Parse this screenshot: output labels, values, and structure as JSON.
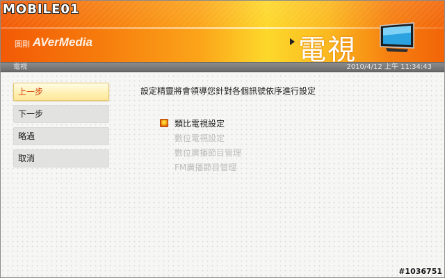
{
  "watermark": {
    "logo": "MOBILE01",
    "id_tag": "#1036751"
  },
  "header": {
    "brand_cn": "圓剛",
    "brand_logo": "AVerMedia",
    "title": "電視",
    "tv_icon": "tv-icon",
    "colors": {
      "gradient_start": "#f25a06",
      "gradient_mid": "#fdd82a",
      "gradient_end": "#f26508"
    }
  },
  "status": {
    "section": "電視",
    "datetime": "2010/4/12 上午 11:34:43"
  },
  "nav": [
    {
      "label": "上一步",
      "active": true
    },
    {
      "label": "下一步",
      "active": false
    },
    {
      "label": "略過",
      "active": false
    },
    {
      "label": "取消",
      "active": false
    }
  ],
  "main": {
    "instruction": "設定精靈將會領導您針對各個訊號依序進行設定",
    "steps": [
      {
        "label": "類比電視設定",
        "state": "current"
      },
      {
        "label": "數位電視設定",
        "state": "pending"
      },
      {
        "label": "數位廣播節目管理",
        "state": "pending"
      },
      {
        "label": "FM廣播節目管理",
        "state": "pending"
      }
    ]
  },
  "colors": {
    "accent": "#d43b00",
    "active_bg": "#fff2b8",
    "pending_text": "#bdbdbd"
  }
}
